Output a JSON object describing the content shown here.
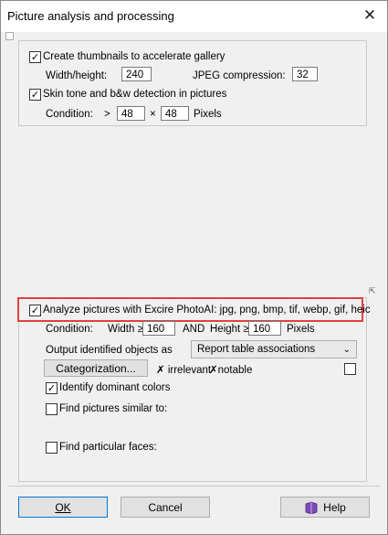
{
  "window": {
    "title": "Picture analysis and processing",
    "close_glyph": "✕"
  },
  "thumbs": {
    "checkbox_label": "Create thumbnails to accelerate gallery",
    "checked": true,
    "wh_label": "Width/height:",
    "wh_value": "240",
    "jpeg_label": "JPEG compression:",
    "jpeg_value": "32"
  },
  "skin": {
    "checkbox_label": "Skin tone and b&w detection in pictures",
    "checked": true,
    "cond_label": "Condition:",
    "gt": ">",
    "w": "48",
    "x": "×",
    "h": "48",
    "unit": "Pixels"
  },
  "resize_glyph": "⇱",
  "excire": {
    "checkbox_label": "Analyze pictures with Excire PhotoAI: jpg, png, bmp, tif, webp, gif, heic",
    "checked": true,
    "cond_label": "Condition:",
    "width_label": "Width ≥",
    "width_value": "160",
    "and_label": "AND",
    "height_label": "Height ≥",
    "height_value": "160",
    "unit": "Pixels",
    "output_label": "Output identified objects as",
    "output_value": "Report table associations",
    "categorization_button": "Categorization...",
    "irrelevant": "✗ irrelevant",
    "notable": "✗notable",
    "dominant_label": "Identify dominant colors",
    "dominant_checked": true,
    "similar_label": "Find pictures similar to:",
    "faces_label": "Find particular faces:"
  },
  "buttons": {
    "ok": "OK",
    "cancel": "Cancel",
    "help": "Help"
  },
  "colors": {
    "highlight": "#e0413e",
    "help_icon": "#7b4bb5"
  }
}
